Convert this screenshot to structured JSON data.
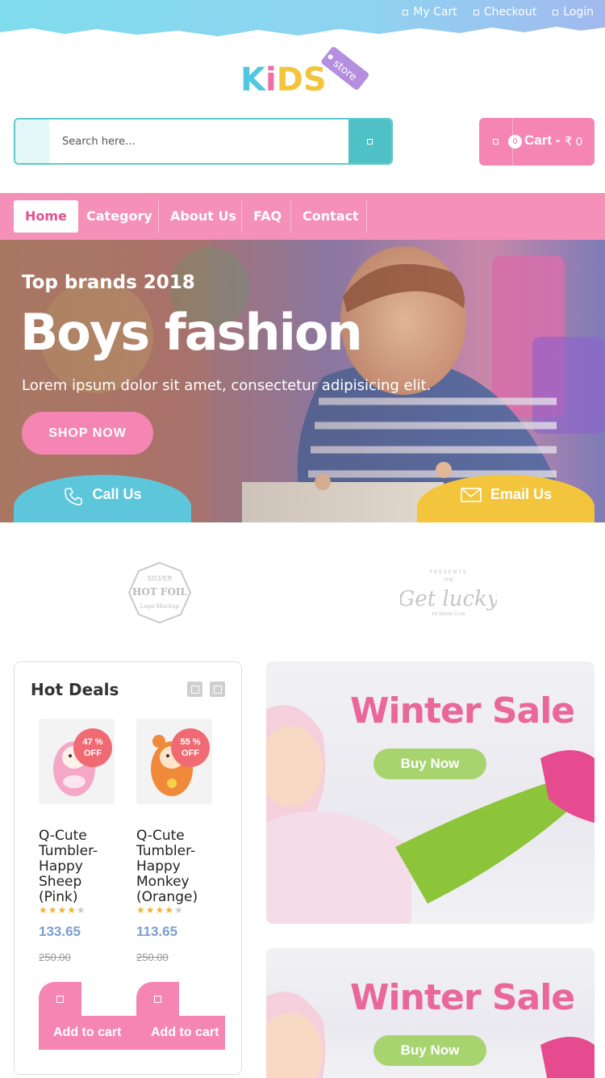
{
  "topbar": {
    "links": [
      {
        "label": "My Cart",
        "icon": "cart-icon"
      },
      {
        "label": "Checkout",
        "icon": "checkout-icon"
      },
      {
        "label": "Login",
        "icon": "login-icon"
      }
    ]
  },
  "logo": {
    "text": "KiDS",
    "tag": "store"
  },
  "search": {
    "placeholder": "Search here..."
  },
  "cart": {
    "count": "0",
    "label": "Cart -",
    "amount": "₹ 0"
  },
  "nav": {
    "items": [
      "Home",
      "Category",
      "About Us",
      "FAQ",
      "Contact"
    ],
    "active": "Home"
  },
  "hero": {
    "kicker": "Top brands 2018",
    "title": "Boys fashion",
    "text": "Lorem ipsum dolor sit amet, consectetur adipisicing elit.",
    "shop_button": "SHOP NOW",
    "call_label": "Call Us",
    "email_label": "Email Us"
  },
  "brands": [
    {
      "lines": [
        "SILVER",
        "HOT FOIL",
        "Logo Mockup"
      ]
    },
    {
      "lines": [
        "PRESENTS",
        "THE",
        "Get lucky",
        "ED BRAND CLUB"
      ]
    }
  ],
  "deals": {
    "title": "Hot Deals",
    "products": [
      {
        "discount": "47 %",
        "off": "OFF",
        "name": "Q-Cute Tumbler-Happy Sheep (Pink)",
        "rating": 4,
        "price": "133.65",
        "old_price": "250.00",
        "add_label": "Add to cart"
      },
      {
        "discount": "55 %",
        "off": "OFF",
        "name": "Q-Cute Tumbler-Happy Monkey (Orange)",
        "rating": 4,
        "price": "113.65",
        "old_price": "250.00",
        "add_label": "Add to cart"
      }
    ]
  },
  "banners": [
    {
      "title": "Winter Sale",
      "button": "Buy Now"
    },
    {
      "title": "Winter Sale",
      "button": "Buy Now"
    }
  ],
  "colors": {
    "pink": "#f586b4",
    "teal": "#4fc1c6",
    "yellow": "#f2c53d",
    "green": "#a7d46f",
    "blue_sky": "#5dc6da"
  }
}
